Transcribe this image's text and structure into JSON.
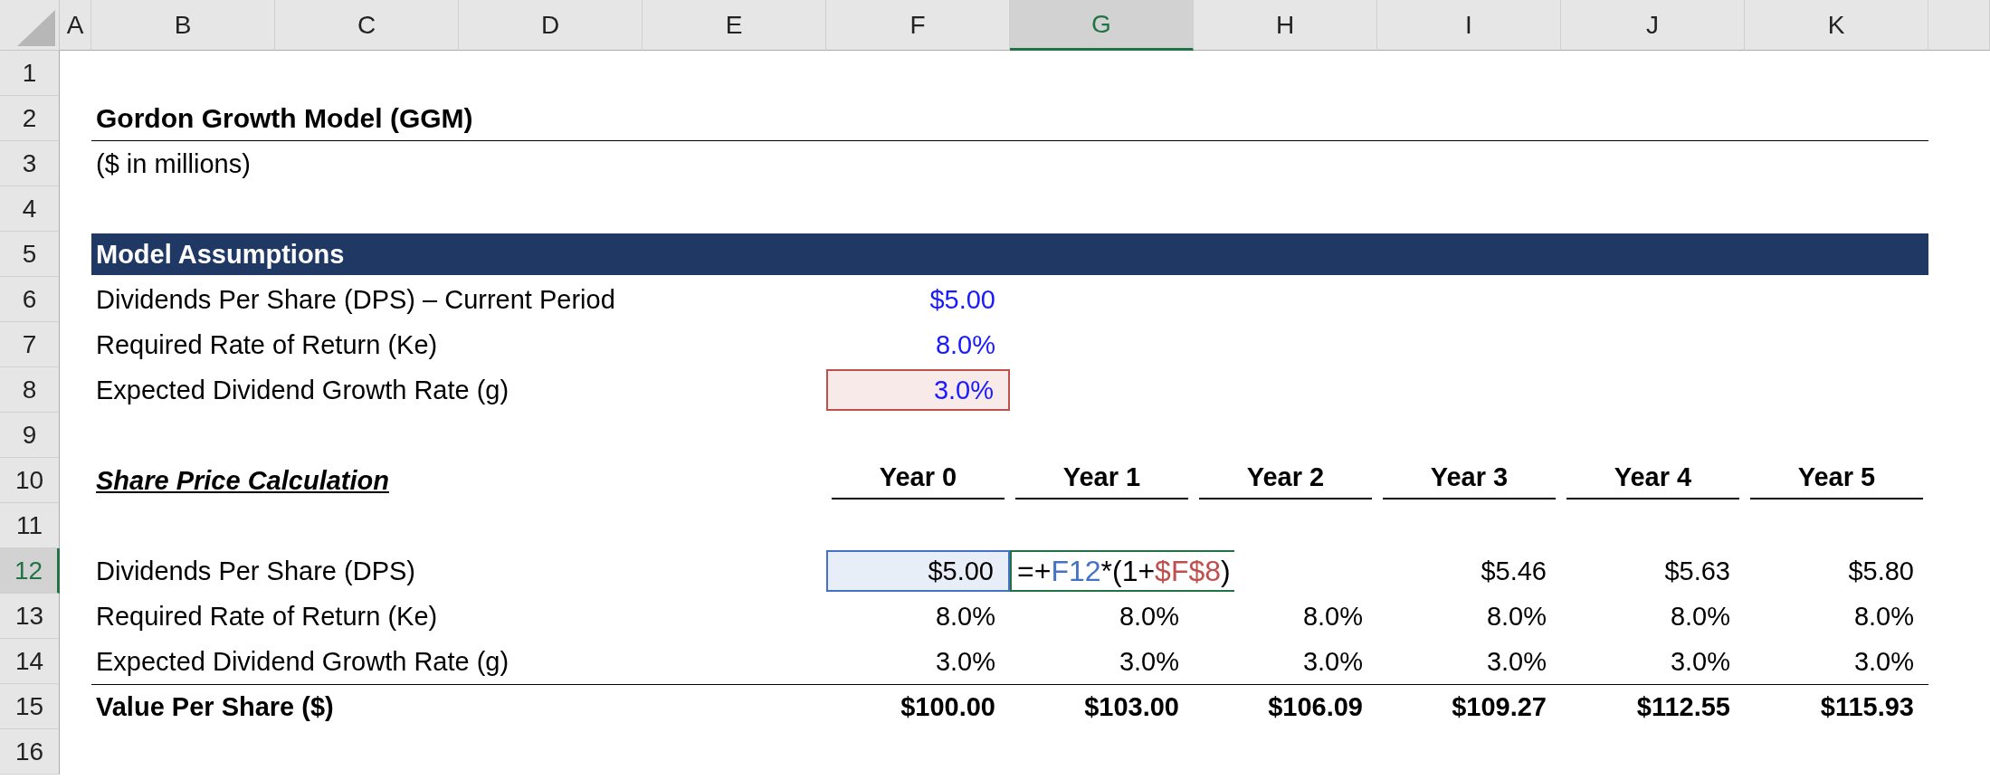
{
  "column_headers": [
    {
      "label": "A",
      "selected": false
    },
    {
      "label": "B",
      "selected": false
    },
    {
      "label": "C",
      "selected": false
    },
    {
      "label": "D",
      "selected": false
    },
    {
      "label": "E",
      "selected": false
    },
    {
      "label": "F",
      "selected": false
    },
    {
      "label": "G",
      "selected": true
    },
    {
      "label": "H",
      "selected": false
    },
    {
      "label": "I",
      "selected": false
    },
    {
      "label": "J",
      "selected": false
    },
    {
      "label": "K",
      "selected": false
    }
  ],
  "rows": [
    {
      "number": "1",
      "selected": false,
      "kind": "blank"
    },
    {
      "number": "2",
      "selected": false,
      "kind": "title",
      "text": "Gordon Growth Model (GGM)"
    },
    {
      "number": "3",
      "selected": false,
      "kind": "subtitle",
      "text": "($ in millions)"
    },
    {
      "number": "4",
      "selected": false,
      "kind": "blank"
    },
    {
      "number": "5",
      "selected": false,
      "kind": "band",
      "text": "Model Assumptions"
    },
    {
      "number": "6",
      "selected": false,
      "kind": "input",
      "label": "Dividends Per Share (DPS) – Current Period",
      "cell": {
        "kind": "value",
        "text": "$5.00"
      }
    },
    {
      "number": "7",
      "selected": false,
      "kind": "input",
      "label": "Required Rate of Return (Ke)",
      "cell": {
        "kind": "value",
        "text": "8.0%"
      }
    },
    {
      "number": "8",
      "selected": false,
      "kind": "input",
      "label": "Expected Dividend Growth Rate (g)",
      "cell": {
        "kind": "reference",
        "text": "3.0%",
        "color": "#c0504d"
      }
    },
    {
      "number": "9",
      "selected": false,
      "kind": "blank"
    },
    {
      "number": "10",
      "selected": false,
      "kind": "section",
      "text": "Share Price Calculation",
      "years": [
        "Year 0",
        "Year 1",
        "Year 2",
        "Year 3",
        "Year 4",
        "Year 5"
      ]
    },
    {
      "number": "11",
      "selected": false,
      "kind": "blank"
    },
    {
      "number": "12",
      "selected": true,
      "kind": "data",
      "label": "Dividends Per Share (DPS)",
      "cells": [
        {
          "kind": "reference",
          "text": "$5.00",
          "color": "#4472c4"
        },
        {
          "kind": "formula",
          "tokens": [
            {
              "text": "=+",
              "color": "#000000"
            },
            {
              "text": "F12",
              "color": "#4472c4"
            },
            {
              "text": "*(1+",
              "color": "#000000"
            },
            {
              "text": "$F$8",
              "color": "#c0504d"
            },
            {
              "text": ")",
              "color": "#000000"
            }
          ]
        },
        {
          "kind": "blank"
        },
        {
          "kind": "value",
          "text": "$5.46"
        },
        {
          "kind": "value",
          "text": "$5.63"
        },
        {
          "kind": "value",
          "text": "$5.80"
        }
      ]
    },
    {
      "number": "13",
      "selected": false,
      "kind": "data",
      "label": "Required Rate of Return (Ke)",
      "cells": [
        {
          "kind": "value",
          "text": "8.0%"
        },
        {
          "kind": "value",
          "text": "8.0%"
        },
        {
          "kind": "value",
          "text": "8.0%"
        },
        {
          "kind": "value",
          "text": "8.0%"
        },
        {
          "kind": "value",
          "text": "8.0%"
        },
        {
          "kind": "value",
          "text": "8.0%"
        }
      ]
    },
    {
      "number": "14",
      "selected": false,
      "kind": "data",
      "label": "Expected Dividend Growth Rate (g)",
      "cells": [
        {
          "kind": "value",
          "text": "3.0%"
        },
        {
          "kind": "value",
          "text": "3.0%"
        },
        {
          "kind": "value",
          "text": "3.0%"
        },
        {
          "kind": "value",
          "text": "3.0%"
        },
        {
          "kind": "value",
          "text": "3.0%"
        },
        {
          "kind": "value",
          "text": "3.0%"
        }
      ]
    },
    {
      "number": "15",
      "selected": false,
      "kind": "total",
      "label": "Value Per Share ($)",
      "cells": [
        {
          "kind": "value",
          "text": "$100.00"
        },
        {
          "kind": "value",
          "text": "$103.00"
        },
        {
          "kind": "value",
          "text": "$106.09"
        },
        {
          "kind": "value",
          "text": "$109.27"
        },
        {
          "kind": "value",
          "text": "$112.55"
        },
        {
          "kind": "value",
          "text": "$115.93"
        }
      ]
    },
    {
      "number": "16",
      "selected": false,
      "kind": "blank"
    }
  ]
}
